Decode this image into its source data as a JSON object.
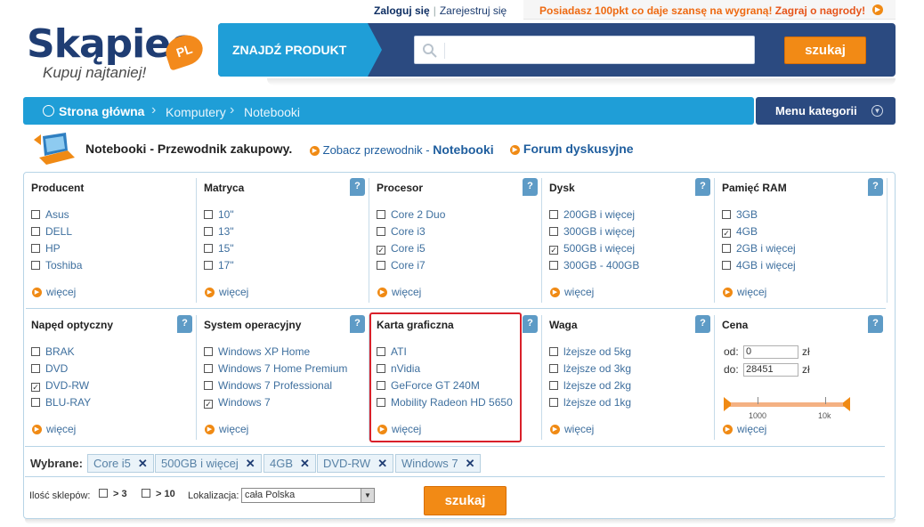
{
  "topbar": {
    "login": "Zaloguj się",
    "separator": "|",
    "register": "Zarejestruj się",
    "promo_text": "Posiadasz 100pkt co daje szansę na wygraną!",
    "promo_link": "Zagraj o nagrody!"
  },
  "logo": {
    "name": "Skąpiec",
    "badge": "PL",
    "slogan": "Kupuj najtaniej!"
  },
  "search": {
    "label": "ZNAJDŹ PRODUKT",
    "placeholder": "",
    "button": "szukaj"
  },
  "breadcrumb": {
    "home": "Strona główna",
    "sep": "›",
    "items": [
      "Komputery",
      "Notebooki"
    ]
  },
  "menu_categories": "Menu kategorii",
  "guide": {
    "title": "Notebooki - Przewodnik zakupowy.",
    "see_guide_prefix": "Zobacz przewodnik -",
    "see_guide_link": "Notebooki",
    "forum": "Forum dyskusyjne"
  },
  "more_label": "więcej",
  "help_label": "?",
  "filters_row1": [
    {
      "title": "Producent",
      "help": false,
      "items": [
        {
          "label": "Asus",
          "checked": false
        },
        {
          "label": "DELL",
          "checked": false
        },
        {
          "label": "HP",
          "checked": false
        },
        {
          "label": "Toshiba",
          "checked": false
        }
      ]
    },
    {
      "title": "Matryca",
      "help": true,
      "items": [
        {
          "label": "10\"",
          "checked": false
        },
        {
          "label": "13\"",
          "checked": false
        },
        {
          "label": "15\"",
          "checked": false
        },
        {
          "label": "17\"",
          "checked": false
        }
      ]
    },
    {
      "title": "Procesor",
      "help": true,
      "items": [
        {
          "label": "Core 2 Duo",
          "checked": false
        },
        {
          "label": "Core i3",
          "checked": false
        },
        {
          "label": "Core i5",
          "checked": true
        },
        {
          "label": "Core i7",
          "checked": false
        }
      ]
    },
    {
      "title": "Dysk",
      "help": true,
      "items": [
        {
          "label": "200GB i więcej",
          "checked": false
        },
        {
          "label": "300GB i więcej",
          "checked": false
        },
        {
          "label": "500GB i więcej",
          "checked": true
        },
        {
          "label": "300GB - 400GB",
          "checked": false
        }
      ]
    },
    {
      "title": "Pamięć RAM",
      "help": true,
      "items": [
        {
          "label": "3GB",
          "checked": false
        },
        {
          "label": "4GB",
          "checked": true
        },
        {
          "label": "2GB i więcej",
          "checked": false
        },
        {
          "label": "4GB i więcej",
          "checked": false
        }
      ]
    }
  ],
  "filters_row2": [
    {
      "title": "Napęd optyczny",
      "help": true,
      "items": [
        {
          "label": "BRAK",
          "checked": false
        },
        {
          "label": "DVD",
          "checked": false
        },
        {
          "label": "DVD-RW",
          "checked": true
        },
        {
          "label": "BLU-RAY",
          "checked": false
        }
      ]
    },
    {
      "title": "System operacyjny",
      "help": true,
      "items": [
        {
          "label": "Windows XP Home",
          "checked": false
        },
        {
          "label": "Windows 7 Home Premium",
          "checked": false
        },
        {
          "label": "Windows 7 Professional",
          "checked": false
        },
        {
          "label": "Windows 7",
          "checked": true
        }
      ]
    },
    {
      "title": "Karta graficzna",
      "help": true,
      "items": [
        {
          "label": "ATI",
          "checked": false
        },
        {
          "label": "nVidia",
          "checked": false
        },
        {
          "label": "GeForce GT 240M",
          "checked": false
        },
        {
          "label": "Mobility Radeon HD 5650",
          "checked": false
        }
      ]
    },
    {
      "title": "Waga",
      "help": true,
      "items": [
        {
          "label": "lżejsze od 5kg",
          "checked": false
        },
        {
          "label": "lżejsze od 3kg",
          "checked": false
        },
        {
          "label": "lżejsze od 2kg",
          "checked": false
        },
        {
          "label": "lżejsze od 1kg",
          "checked": false
        }
      ]
    }
  ],
  "price": {
    "title": "Cena",
    "from_label": "od:",
    "from_value": "0",
    "to_label": "do:",
    "to_value": "28451",
    "currency": "zł",
    "tick1": "1000",
    "tick2": "10k"
  },
  "selected": {
    "label": "Wybrane:",
    "chips": [
      "Core i5",
      "500GB i więcej",
      "4GB",
      "DVD-RW",
      "Windows 7"
    ],
    "remove": "✕"
  },
  "footer": {
    "shops_label": "Ilość sklepów:",
    "opt1": "> 3",
    "opt2": "> 10",
    "location_label": "Lokalizacja:",
    "location_value": "cała Polska",
    "button": "szukaj"
  }
}
